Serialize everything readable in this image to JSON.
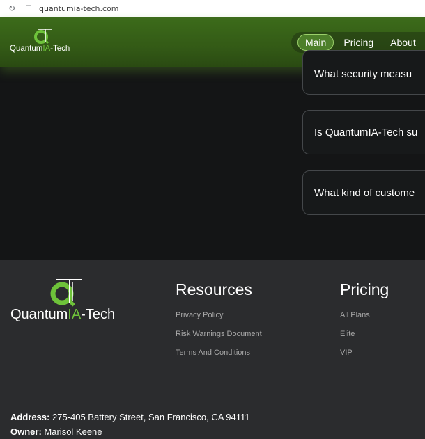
{
  "browser": {
    "url": "quantumia-tech.com"
  },
  "header": {
    "brand": {
      "prefix": "Quantum",
      "accent": "IA",
      "suffix": "-Tech"
    },
    "nav": [
      {
        "label": "Main",
        "active": true
      },
      {
        "label": "Pricing",
        "active": false
      },
      {
        "label": "About",
        "active": false
      }
    ]
  },
  "faq": [
    "What security measu",
    "Is QuantumIA-Tech su",
    "What kind of custome"
  ],
  "footer": {
    "brand": {
      "prefix": "Quantum",
      "accent": "IA",
      "suffix": "-Tech"
    },
    "resources": {
      "title": "Resources",
      "links": [
        "Privacy Policy",
        "Risk Warnings Document",
        "Terms And Conditions"
      ]
    },
    "pricing": {
      "title": "Pricing",
      "links": [
        "All Plans",
        "Elite",
        "VIP"
      ]
    },
    "address_label": "Address:",
    "address_value": "275-405 Battery Street, San Francisco, CA 94111",
    "owner_label": "Owner:",
    "owner_value": "Marisol Keene"
  },
  "colors": {
    "accent": "#6ec23a",
    "header_bg": "#335a16",
    "footer_bg": "#2b2c2e",
    "page_bg": "#141516"
  }
}
